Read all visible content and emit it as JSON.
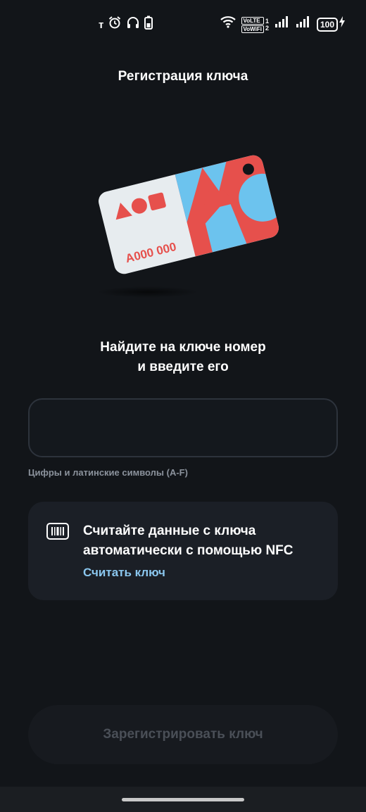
{
  "status_bar": {
    "left_icons": [
      "carrier-t-icon",
      "alarm-icon",
      "headphones-icon",
      "battery-saver-icon"
    ],
    "volte_label": "VoLTE",
    "vowifi_label": "VoWiFi",
    "sim1": "1",
    "sim2": "2",
    "battery": "100"
  },
  "header": {
    "title": "Регистрация ключа"
  },
  "card": {
    "number": "A000 000"
  },
  "prompt": {
    "line1": "Найдите на ключе номер",
    "line2": "и введите его"
  },
  "key_input": {
    "value": "",
    "placeholder": ""
  },
  "input_hint": "Цифры и латинские символы (A-F)",
  "nfc": {
    "line1": "Считайте данные с ключа",
    "line2": "автоматически с помощью NFC",
    "link": "Считать ключ"
  },
  "register_button": "Зарегистрировать ключ",
  "colors": {
    "background": "#121519",
    "surface": "#1b1f26",
    "accent_link": "#8bc7ef",
    "card_red": "#e6504c",
    "card_blue": "#6cc3ee"
  }
}
